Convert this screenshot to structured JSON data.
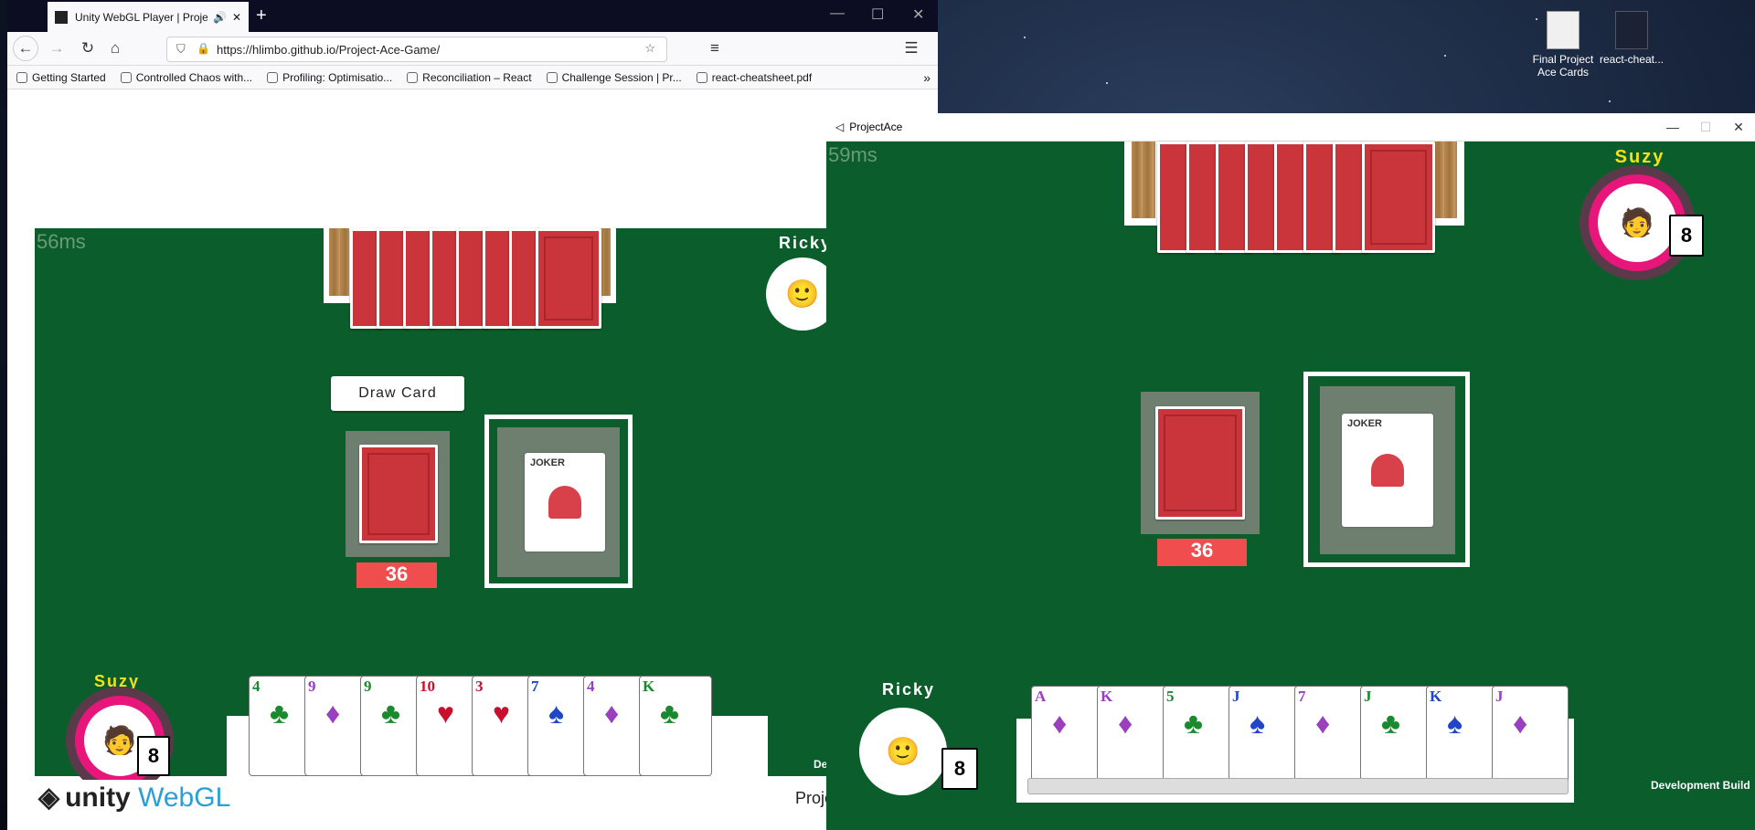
{
  "browser": {
    "tab_title": "Unity WebGL Player | Proje",
    "url": "https://hlimbo.github.io/Project-Ace-Game/",
    "bookmarks": [
      "Getting Started",
      "Controlled Chaos with...",
      "Profiling: Optimisatio...",
      "Reconciliation – React",
      "Challenge Session | Pr...",
      "react-cheatsheet.pdf"
    ]
  },
  "desktop": {
    "icons": [
      {
        "label": "Final Project Ace Cards"
      },
      {
        "label": "react-cheat..."
      }
    ]
  },
  "game_left": {
    "fps": "56ms",
    "opponent": "Ricky",
    "player": "Suzy",
    "player_count": "8",
    "draw_button": "Draw Card",
    "deck_count": "36",
    "joker_label": "JOKER",
    "hand": [
      {
        "rank": "4",
        "suit": "♣",
        "color": "#1b8a2f"
      },
      {
        "rank": "9",
        "suit": "♦",
        "color": "#9a3fbf"
      },
      {
        "rank": "9",
        "suit": "♣",
        "color": "#1b8a2f"
      },
      {
        "rank": "10",
        "suit": "♥",
        "color": "#c8102e"
      },
      {
        "rank": "3",
        "suit": "♥",
        "color": "#c8102e"
      },
      {
        "rank": "7",
        "suit": "♠",
        "color": "#2246c8"
      },
      {
        "rank": "4",
        "suit": "♦",
        "color": "#9a3fbf"
      },
      {
        "rank": "K",
        "suit": "♣",
        "color": "#1b8a2f"
      }
    ],
    "dev_build": "Dev"
  },
  "footer_left": {
    "logo_text": "unity",
    "logo_webgl": "WebGL",
    "project_name": "ProjectAce"
  },
  "game_right": {
    "window_title": "ProjectAce",
    "fps": "59ms",
    "opponent": "Suzy",
    "opponent_count": "8",
    "player": "Ricky",
    "player_count": "8",
    "deck_count": "36",
    "joker_label": "JOKER",
    "hand": [
      {
        "rank": "A",
        "suit": "♦",
        "color": "#9a3fbf"
      },
      {
        "rank": "K",
        "suit": "♦",
        "color": "#9a3fbf"
      },
      {
        "rank": "5",
        "suit": "♣",
        "color": "#1b8a2f"
      },
      {
        "rank": "J",
        "suit": "♠",
        "color": "#2246c8"
      },
      {
        "rank": "7",
        "suit": "♦",
        "color": "#9a3fbf"
      },
      {
        "rank": "J",
        "suit": "♣",
        "color": "#1b8a2f"
      },
      {
        "rank": "K",
        "suit": "♠",
        "color": "#2246c8"
      },
      {
        "rank": "J",
        "suit": "♦",
        "color": "#9a3fbf"
      }
    ],
    "dev_build": "Development Build"
  }
}
